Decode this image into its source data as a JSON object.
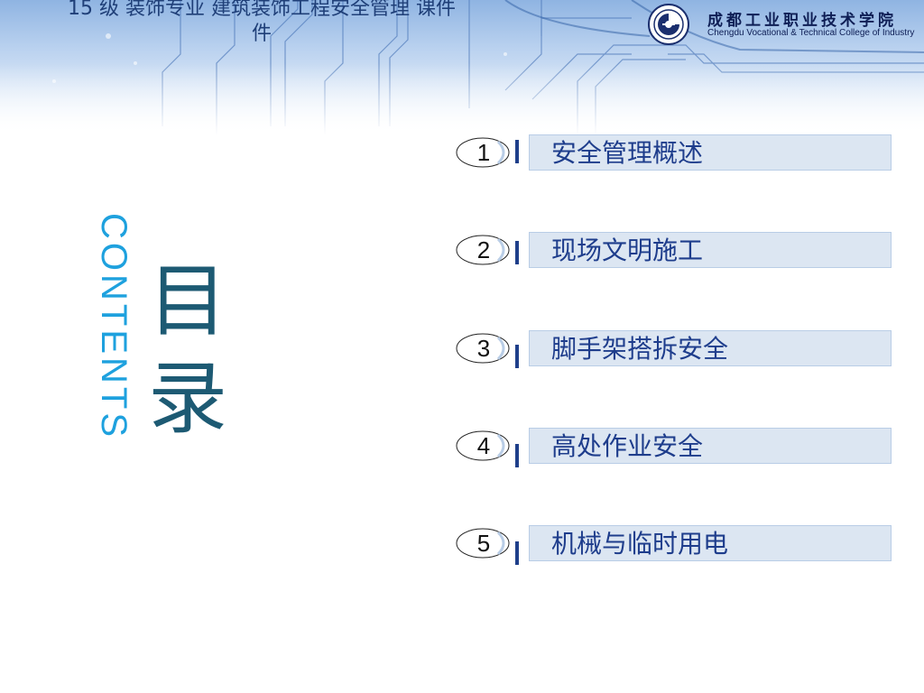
{
  "slide": {
    "title": "15 级 装饰专业 建筑装饰工程安全管理 课件",
    "title_line2": "件"
  },
  "logo": {
    "school_cn": "成都工业职业技术学院",
    "school_en": "Chengdu Vocational & Technical College of Industry"
  },
  "heading": {
    "contents": "CONTENTS",
    "mulu_1": "目",
    "mulu_2": "录"
  },
  "menu": [
    {
      "num": "1",
      "label": "安全管理概述"
    },
    {
      "num": "2",
      "label": "现场文明施工"
    },
    {
      "num": "3",
      "label": "脚手架搭拆安全"
    },
    {
      "num": "4",
      "label": "高处作业安全"
    },
    {
      "num": "5",
      "label": "机械与临时用电"
    }
  ],
  "colors": {
    "title": "#1f3f78",
    "contents": "#1ea1de",
    "mulu": "#1d5a73",
    "menu_text": "#1e3d8c",
    "menu_box": "#dce6f2",
    "marker": "#1f3f8a"
  }
}
